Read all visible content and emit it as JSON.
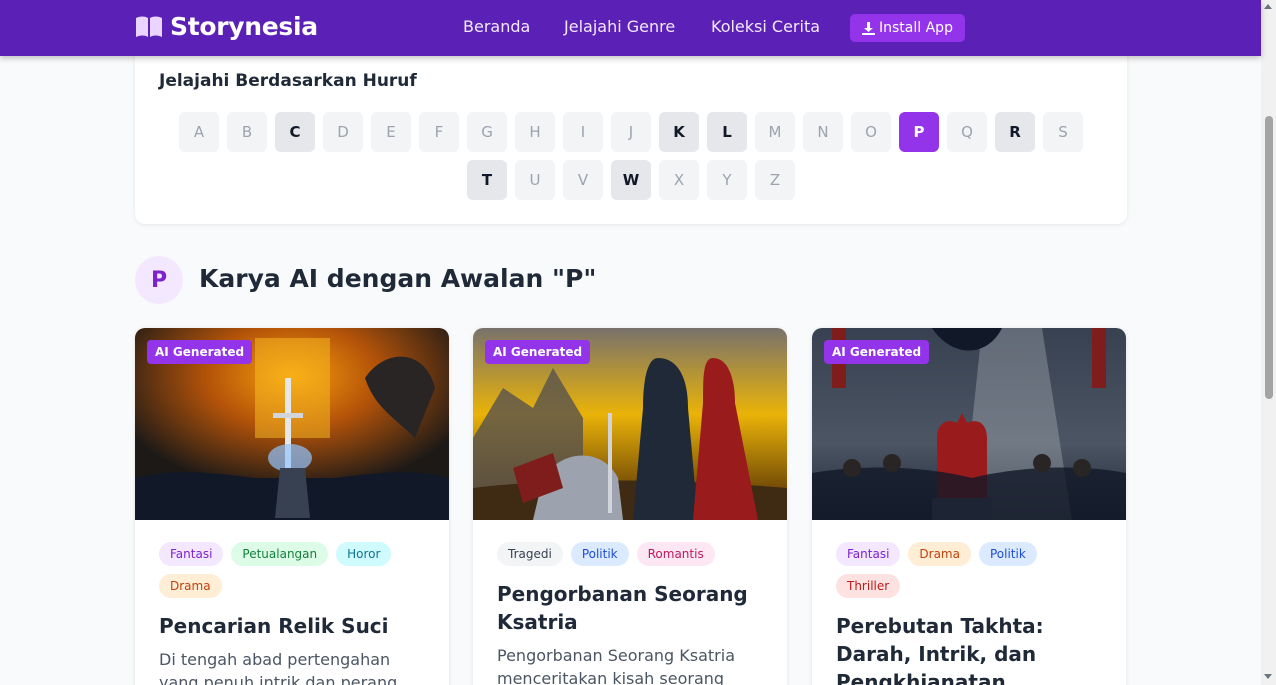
{
  "nav": {
    "brand": "Storynesia",
    "brand_icon": "book-open-icon",
    "links": [
      "Beranda",
      "Jelajahi Genre",
      "Koleksi Cerita"
    ],
    "install_label": "Install App",
    "install_icon": "download-icon",
    "bg_color": "#5b21b6",
    "accent_color": "#9333ea"
  },
  "letters": {
    "title": "Jelajahi Berdasarkan Huruf",
    "items": [
      {
        "label": "A",
        "state": "disabled"
      },
      {
        "label": "B",
        "state": "disabled"
      },
      {
        "label": "C",
        "state": "available"
      },
      {
        "label": "D",
        "state": "disabled"
      },
      {
        "label": "E",
        "state": "disabled"
      },
      {
        "label": "F",
        "state": "disabled"
      },
      {
        "label": "G",
        "state": "disabled"
      },
      {
        "label": "H",
        "state": "disabled"
      },
      {
        "label": "I",
        "state": "disabled"
      },
      {
        "label": "J",
        "state": "disabled"
      },
      {
        "label": "K",
        "state": "available"
      },
      {
        "label": "L",
        "state": "available"
      },
      {
        "label": "M",
        "state": "disabled"
      },
      {
        "label": "N",
        "state": "disabled"
      },
      {
        "label": "O",
        "state": "disabled"
      },
      {
        "label": "P",
        "state": "active"
      },
      {
        "label": "Q",
        "state": "disabled"
      },
      {
        "label": "R",
        "state": "available"
      },
      {
        "label": "S",
        "state": "disabled"
      },
      {
        "label": "T",
        "state": "available"
      },
      {
        "label": "U",
        "state": "disabled"
      },
      {
        "label": "V",
        "state": "disabled"
      },
      {
        "label": "W",
        "state": "available"
      },
      {
        "label": "X",
        "state": "disabled"
      },
      {
        "label": "Y",
        "state": "disabled"
      },
      {
        "label": "Z",
        "state": "disabled"
      }
    ]
  },
  "section": {
    "badge_letter": "P",
    "title": "Karya AI dengan Awalan \"P\""
  },
  "cards": [
    {
      "badge": "AI Generated",
      "tags": [
        {
          "label": "Fantasi",
          "color": "purple"
        },
        {
          "label": "Petualangan",
          "color": "green"
        },
        {
          "label": "Horor",
          "color": "cyan"
        },
        {
          "label": "Drama",
          "color": "orange"
        }
      ],
      "title": "Pencarian Relik Suci",
      "description": "Di tengah abad pertengahan yang penuh intrik dan perang"
    },
    {
      "badge": "AI Generated",
      "tags": [
        {
          "label": "Tragedi",
          "color": "gray"
        },
        {
          "label": "Politik",
          "color": "blue"
        },
        {
          "label": "Romantis",
          "color": "pink"
        }
      ],
      "title": "Pengorbanan Seorang Ksatria",
      "description": "Pengorbanan Seorang Ksatria menceritakan kisah seorang"
    },
    {
      "badge": "AI Generated",
      "tags": [
        {
          "label": "Fantasi",
          "color": "purple"
        },
        {
          "label": "Drama",
          "color": "orange"
        },
        {
          "label": "Politik",
          "color": "blue"
        },
        {
          "label": "Thriller",
          "color": "red"
        }
      ],
      "title": "Perebutan Takhta: Darah, Intrik, dan Pengkhianatan",
      "description": ""
    }
  ]
}
